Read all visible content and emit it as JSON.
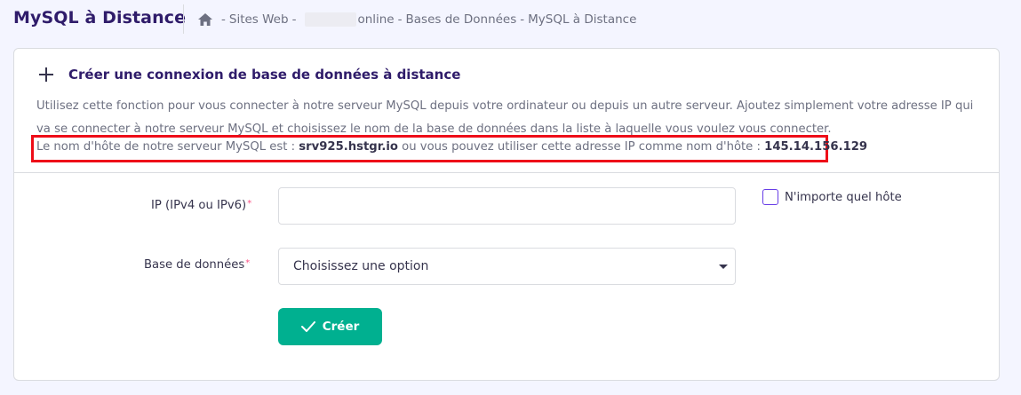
{
  "header": {
    "title": "MySQL à Distance",
    "breadcrumb": {
      "sep": "-",
      "sites_web": "Sites Web",
      "domain_suffix": "online",
      "databases": "Bases de Données",
      "current": "MySQL à Distance"
    }
  },
  "card": {
    "title": "Créer une connexion de base de données à distance",
    "description": "Utilisez cette fonction pour vous connecter à notre serveur MySQL depuis votre ordinateur ou depuis un autre serveur. Ajoutez simplement votre adresse IP qui va se connecter à notre serveur MySQL et choisissez le nom de la base de données dans la liste à laquelle vous voulez vous connecter.",
    "host_prefix": "Le nom d'hôte de notre serveur MySQL est :",
    "hostname": "srv925.hstgr.io",
    "host_middle": "ou vous pouvez utiliser cette adresse IP comme nom d'hôte :",
    "host_ip": "145.14.156.129"
  },
  "form": {
    "ip_label": "IP (IPv4 ou IPv6)",
    "ip_value": "",
    "required_mark": "*",
    "any_host_label": "N'importe quel hôte",
    "any_host_checked": false,
    "db_label": "Base de données",
    "db_selected": "Choisissez une option",
    "create_label": "Créer"
  },
  "colors": {
    "accent": "#673de6",
    "button": "#00b090",
    "highlight": "#ee0d18",
    "title": "#2f1c6a"
  }
}
